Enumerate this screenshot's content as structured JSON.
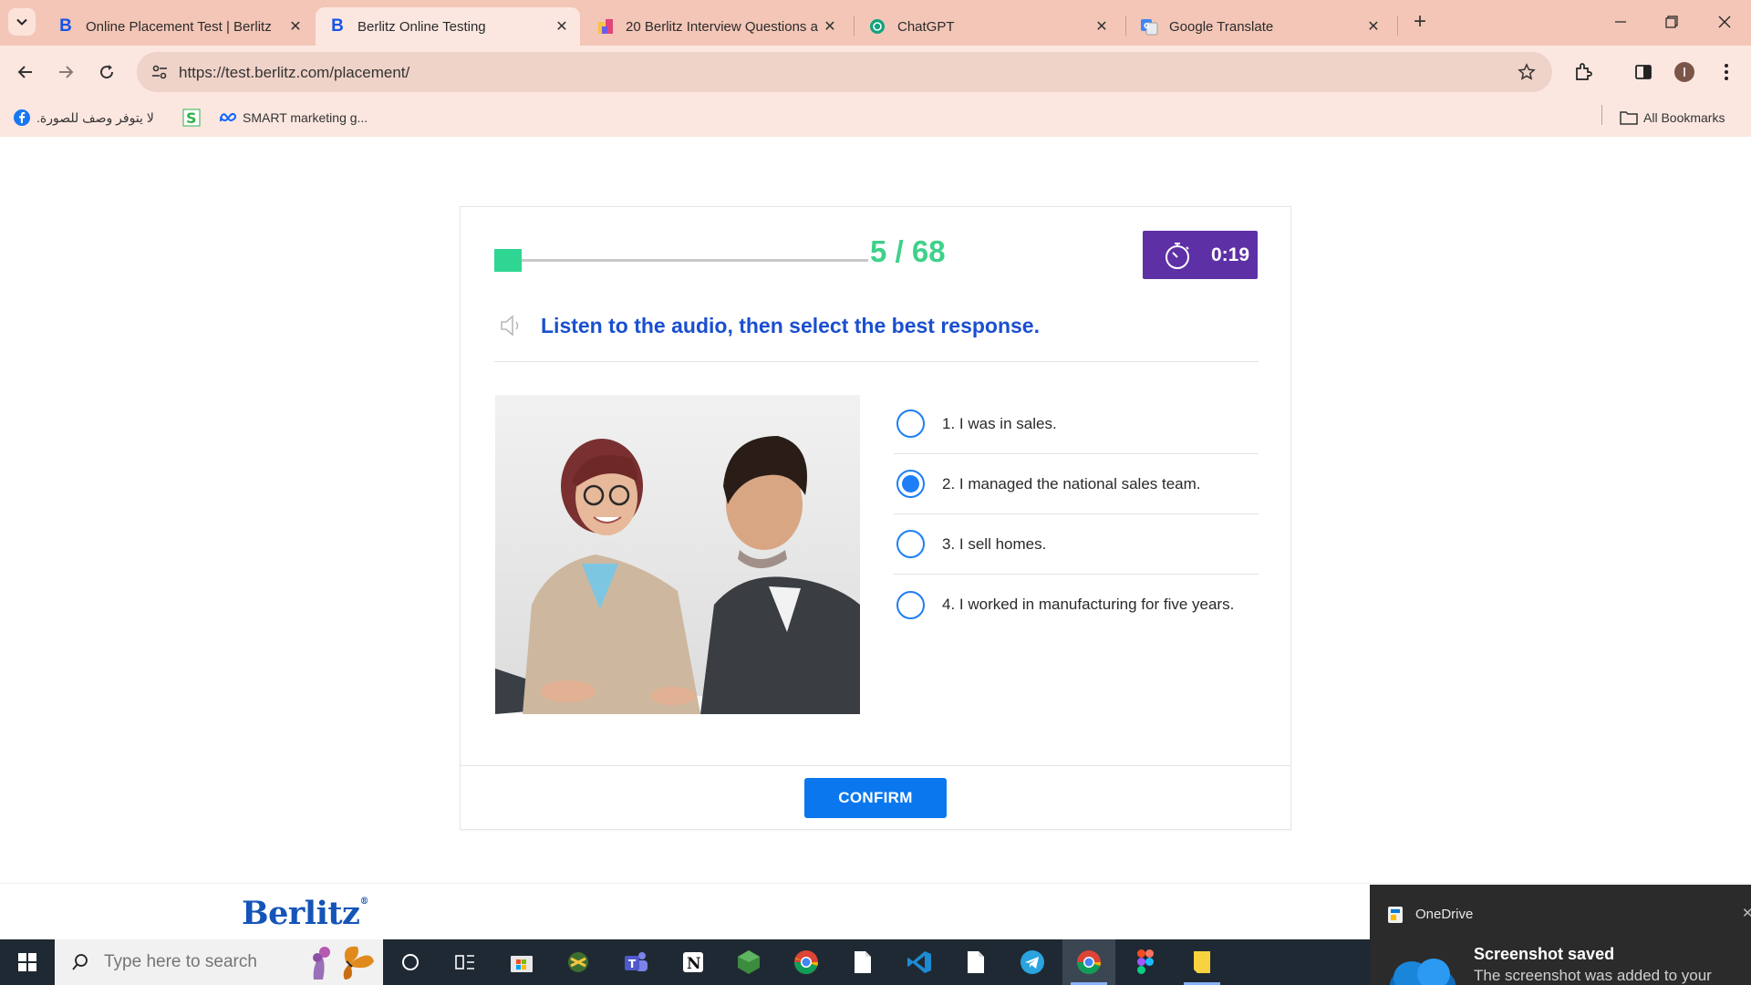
{
  "browser": {
    "tabs": [
      {
        "title": "Online Placement Test | Berlitz",
        "icon": "berlitz-b-icon",
        "active": false
      },
      {
        "title": "Berlitz Online Testing",
        "icon": "berlitz-b-icon",
        "active": true
      },
      {
        "title": "20 Berlitz Interview Questions a",
        "icon": "glassdoor-icon",
        "active": false
      },
      {
        "title": "ChatGPT",
        "icon": "chatgpt-icon",
        "active": false
      },
      {
        "title": "Google Translate",
        "icon": "google-translate-icon",
        "active": false
      }
    ],
    "url": "https://test.berlitz.com/placement/",
    "bookmarks": [
      {
        "label": "لا يتوفر وصف للصورة.",
        "icon": "facebook-icon"
      },
      {
        "label": "",
        "icon": "s-logo-icon"
      },
      {
        "label": "SMART marketing g...",
        "icon": "meta-icon"
      }
    ],
    "all_bookmarks_label": "All Bookmarks",
    "accent": "#f3c6b7"
  },
  "test": {
    "progress": {
      "current": 5,
      "total": 68,
      "label": "5 / 68",
      "fraction": 0.0735,
      "color": "#2fd693"
    },
    "timer": {
      "value": "0:19",
      "color": "#5e30a6"
    },
    "instruction": "Listen to the audio, then select the best response.",
    "answers": [
      {
        "label": "1. I was in sales.",
        "selected": false
      },
      {
        "label": "2. I managed the national sales team.",
        "selected": true
      },
      {
        "label": "3. I sell homes.",
        "selected": false
      },
      {
        "label": "4. I worked in manufacturing for five years.",
        "selected": false
      }
    ],
    "confirm_label": "CONFIRM",
    "confirm_color": "#0a77ef"
  },
  "footer": {
    "brand": "Berlitz",
    "brand_mark": "®"
  },
  "taskbar": {
    "search_placeholder": "Type here to search",
    "apps": [
      "cortana-icon",
      "task-view-icon",
      "microsoft-store-icon",
      "app-icon",
      "teams-icon",
      "notion-icon",
      "node-icon",
      "chrome-icon",
      "file-icon",
      "vscode-icon",
      "file-icon",
      "telegram-icon",
      "chrome-icon",
      "figma-icon",
      "sticky-notes-icon"
    ]
  },
  "notification": {
    "app": "OneDrive",
    "title": "Screenshot saved",
    "body": "The screenshot was added to your",
    "close": "✕"
  }
}
